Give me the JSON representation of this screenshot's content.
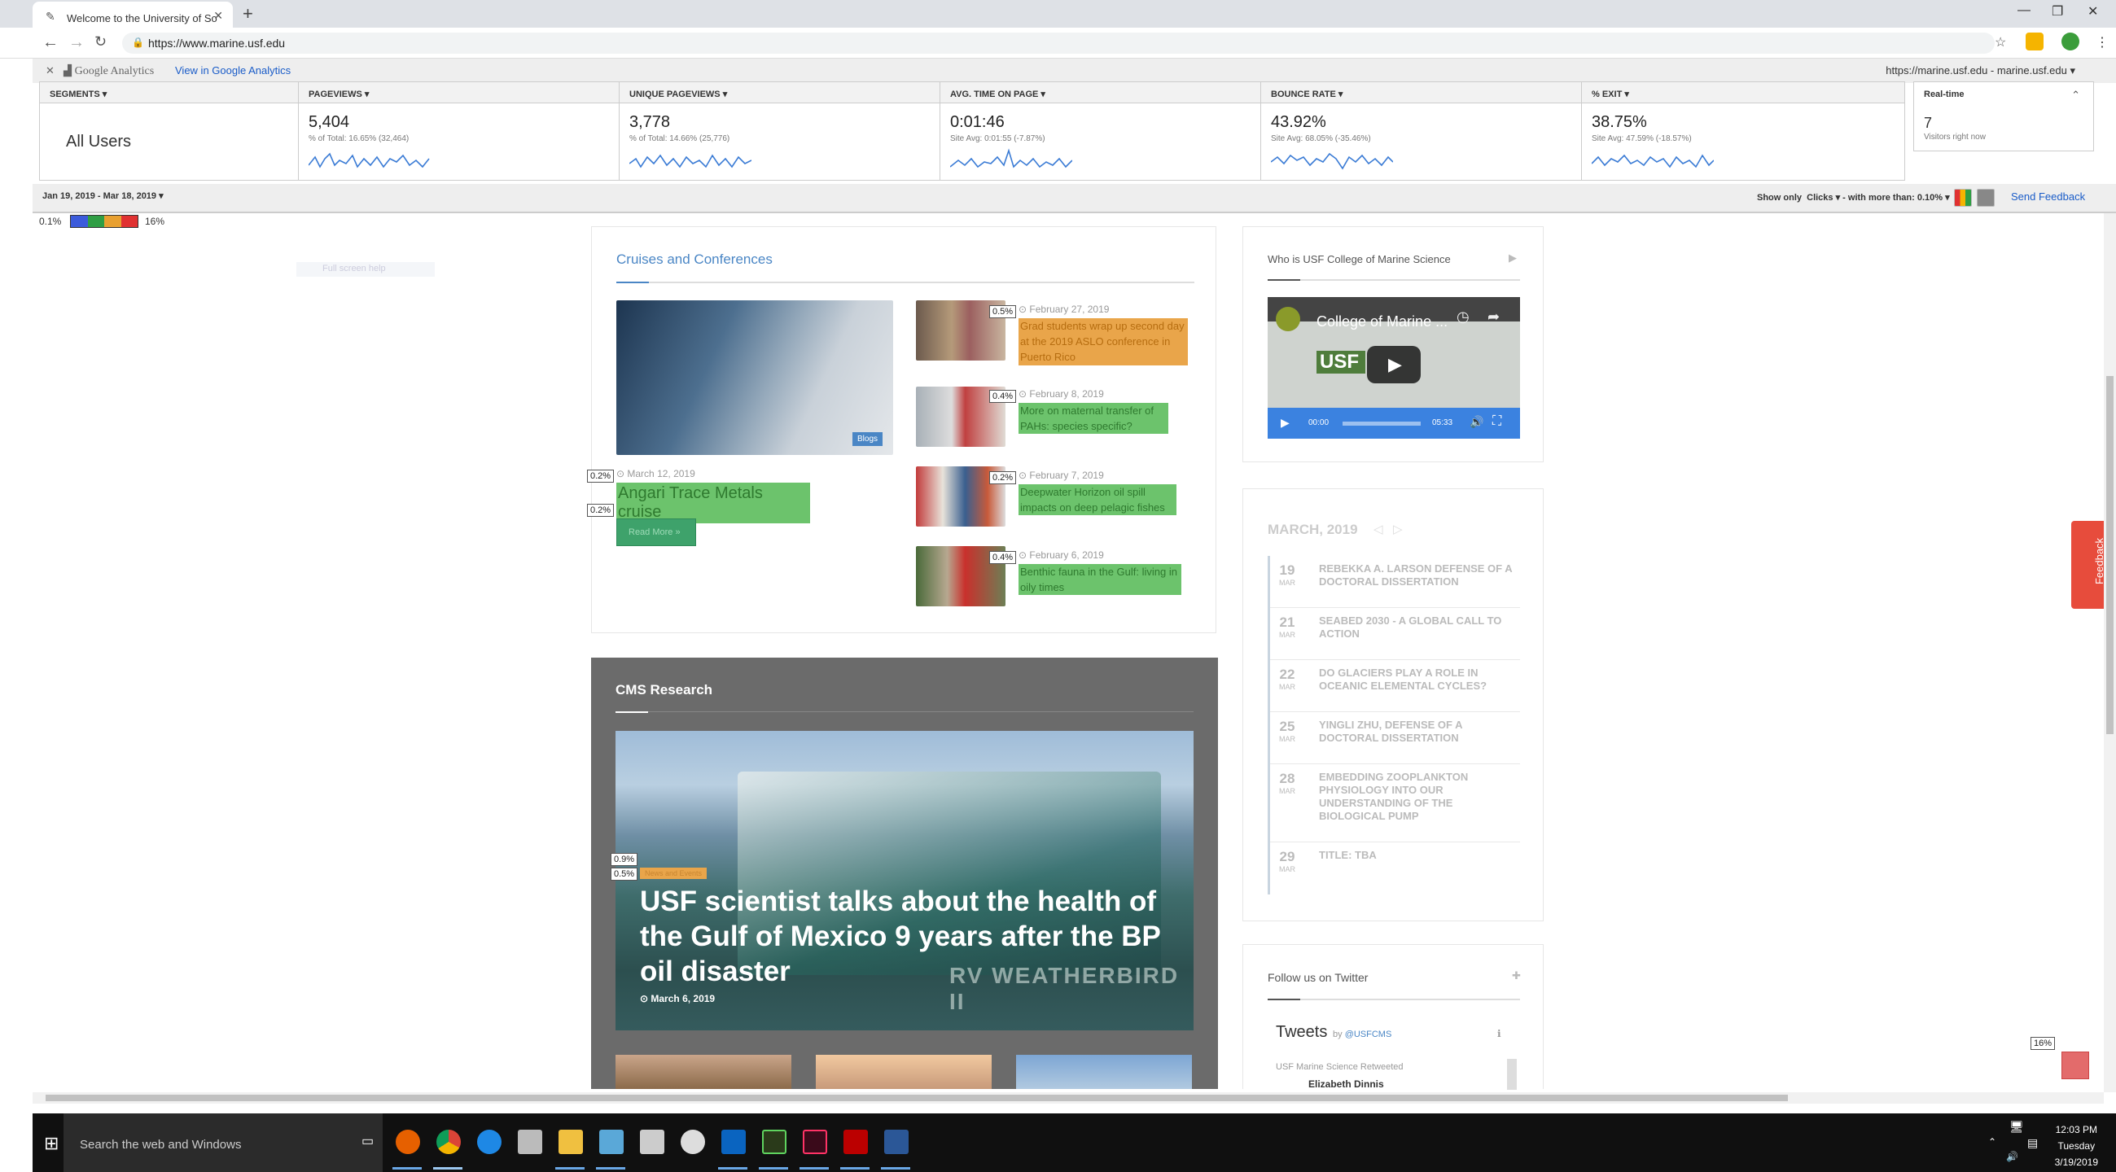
{
  "browser": {
    "tab_title": "Welcome to the University of So",
    "url": "https://www.marine.usf.edu"
  },
  "ga": {
    "logo_text": "Google Analytics",
    "view_link": "View in Google Analytics",
    "site_selector": "https://marine.usf.edu - marine.usf.edu ▾",
    "segments_header": "SEGMENTS ▾",
    "segment_value": "All Users",
    "metrics": [
      {
        "header": "PAGEVIEWS ▾",
        "value": "5,404",
        "sub": "% of Total: 16.65% (32,464)"
      },
      {
        "header": "UNIQUE PAGEVIEWS ▾",
        "value": "3,778",
        "sub": "% of Total: 14.66% (25,776)"
      },
      {
        "header": "AVG. TIME ON PAGE ▾",
        "value": "0:01:46",
        "sub": "Site Avg: 0:01:55 (-7.87%)"
      },
      {
        "header": "BOUNCE RATE ▾",
        "value": "43.92%",
        "sub": "Site Avg: 68.05% (-35.46%)"
      },
      {
        "header": "% EXIT ▾",
        "value": "38.75%",
        "sub": "Site Avg: 47.59% (-18.57%)"
      }
    ],
    "realtime": {
      "header": "Real-time",
      "value": "7",
      "sub": "Visitors right now"
    },
    "date_range": "Jan 19, 2019 - Mar 18, 2019 ▾",
    "show_only": "Show only",
    "clicks": "Clicks ▾",
    "with_more_than": "with more than:",
    "threshold": "0.10% ▾",
    "send_feedback": "Send Feedback",
    "legend_min": "0.1%",
    "legend_max": "16%",
    "legend_colors": [
      "#3b5bdb",
      "#2f9e44",
      "#e8a030",
      "#e03131"
    ]
  },
  "site": {
    "faded_text": "Full screen help",
    "cruises": {
      "title": "Cruises and Conferences",
      "main_badge": "Blogs",
      "main_date": "⊙ March 12, 2019",
      "main_title": "Angari Trace Metals cruise",
      "read_more": "Read More »",
      "main_pcts": [
        "0.2%",
        "0.2%"
      ],
      "items": [
        {
          "pct": "0.5%",
          "date": "⊙ February 27, 2019",
          "title": "Grad students wrap up second day at the 2019 ASLO conference in Puerto Rico"
        },
        {
          "pct": "0.4%",
          "date": "⊙ February 8, 2019",
          "title": "More on maternal transfer of PAHs: species specific?"
        },
        {
          "pct": "0.2%",
          "date": "⊙ February 7, 2019",
          "title": "Deepwater Horizon oil spill impacts on deep pelagic fishes"
        },
        {
          "pct": "0.4%",
          "date": "⊙ February 6, 2019",
          "title": "Benthic fauna in the Gulf: living in oily times"
        }
      ]
    },
    "research": {
      "title": "CMS Research",
      "badge": "News and Events",
      "pcts": [
        "0.9%",
        "0.5%"
      ],
      "headline": "USF scientist talks about the health of the Gulf of Mexico 9 years after the BP oil disaster",
      "date": "⊙ March 6, 2019",
      "ship_text": "RV WEATHERBIRD II"
    },
    "video": {
      "title": "Who is USF College of Marine Science",
      "video_title": "College of Marine ...",
      "time_current": "00:00",
      "time_total": "05:33"
    },
    "calendar": {
      "title": "MARCH, 2019",
      "events": [
        {
          "day": "19",
          "mon": "MAR",
          "title": "REBEKKA A. LARSON DEFENSE OF A DOCTORAL DISSERTATION"
        },
        {
          "day": "21",
          "mon": "MAR",
          "title": "SEABED 2030 - A GLOBAL CALL TO ACTION"
        },
        {
          "day": "22",
          "mon": "MAR",
          "title": "DO GLACIERS PLAY A ROLE IN OCEANIC ELEMENTAL CYCLES?"
        },
        {
          "day": "25",
          "mon": "MAR",
          "title": "YINGLI ZHU, DEFENSE OF A DOCTORAL DISSERTATION"
        },
        {
          "day": "28",
          "mon": "MAR",
          "title": "EMBEDDING ZOOPLANKTON PHYSIOLOGY INTO OUR UNDERSTANDING OF THE BIOLOGICAL PUMP"
        },
        {
          "day": "29",
          "mon": "MAR",
          "title": "TITLE: TBA"
        }
      ]
    },
    "twitter": {
      "title": "Follow us on Twitter",
      "tweets_label": "Tweets",
      "by": "by",
      "handle": "@USFCMS",
      "retweet": "USF Marine Science Retweeted",
      "author": "Elizabeth Dinnis"
    },
    "feedback_tab": "Feedback",
    "overlay_pct": "16%"
  },
  "taskbar": {
    "search_placeholder": "Search the web and Windows",
    "time": "12:03 PM",
    "day": "Tuesday",
    "date": "3/19/2019"
  }
}
